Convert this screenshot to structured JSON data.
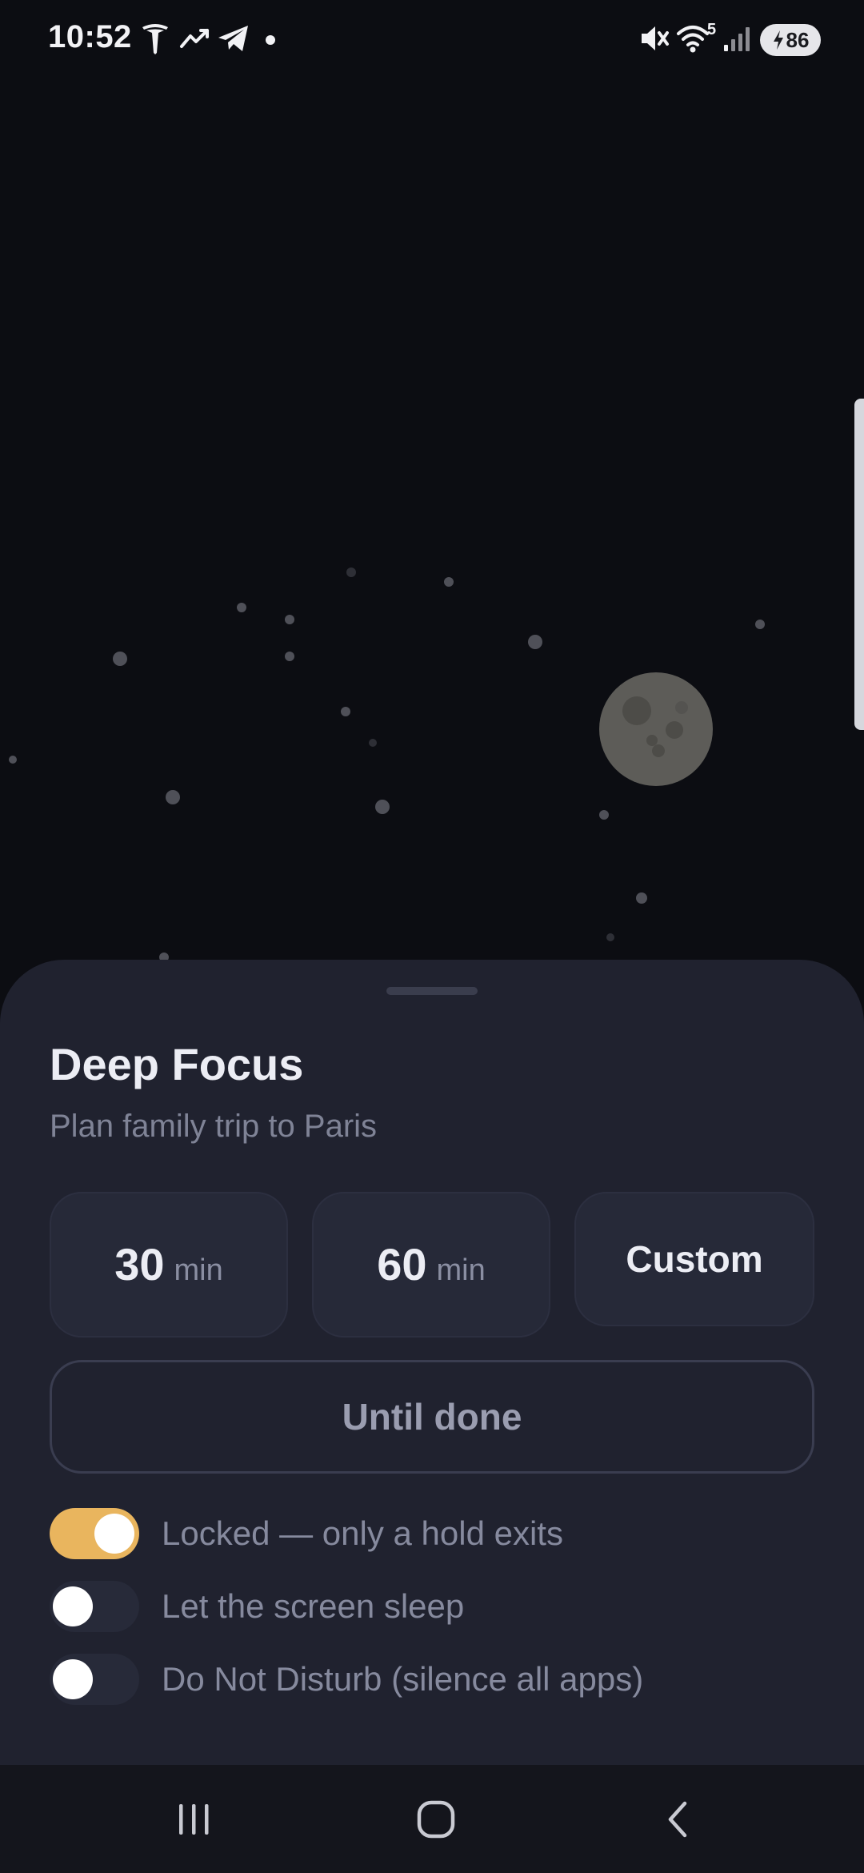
{
  "status_bar": {
    "time": "10:52",
    "notification_icons": [
      "tesla-icon",
      "trending-icon",
      "telegram-icon",
      "dot-icon"
    ],
    "system_icons": [
      "mute-icon",
      "wifi-icon",
      "signal-icon",
      "battery-icon"
    ],
    "wifi_badge": "5",
    "battery_percent": "86"
  },
  "sheet": {
    "title": "Deep Focus",
    "subtitle": "Plan family trip to Paris",
    "durations": [
      {
        "value": "30",
        "unit": "min"
      },
      {
        "value": "60",
        "unit": "min"
      }
    ],
    "custom_label": "Custom",
    "until_done_label": "Until done",
    "toggles": [
      {
        "label": "Locked — only a hold exits",
        "on": true
      },
      {
        "label": "Let the screen sleep",
        "on": false
      },
      {
        "label": "Do Not Disturb (silence all apps)",
        "on": false
      }
    ]
  },
  "colors": {
    "background": "#0c0d12",
    "sheet": "#20222f",
    "accent": "#e9b55e",
    "moon": "#5d5c58"
  },
  "nav_bar": {
    "icons": [
      "recents-icon",
      "home-icon",
      "back-icon"
    ]
  }
}
